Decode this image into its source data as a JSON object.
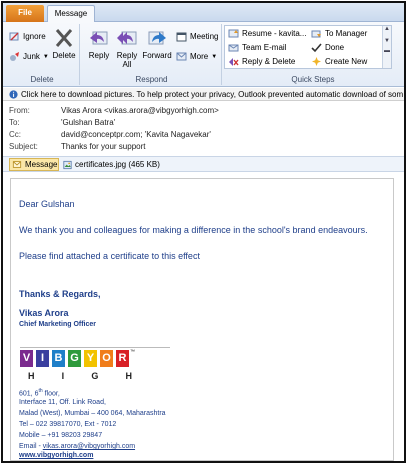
{
  "tabs": {
    "file": "File",
    "message": "Message"
  },
  "ribbon": {
    "delete_group": {
      "ignore": "Ignore",
      "junk": "Junk",
      "delete": "Delete",
      "label": "Delete"
    },
    "respond_group": {
      "reply": "Reply",
      "reply_all_line1": "Reply",
      "reply_all_line2": "All",
      "forward": "Forward",
      "meeting": "Meeting",
      "more": "More",
      "label": "Respond"
    },
    "quick_steps": {
      "items": [
        "Resume - kavita...",
        "Team E-mail",
        "Reply & Delete",
        "To Manager",
        "Done",
        "Create New"
      ],
      "label": "Quick Steps"
    }
  },
  "infobar": {
    "text": "Click here to download pictures. To help protect your privacy, Outlook prevented automatic download of som"
  },
  "header": {
    "from_label": "From:",
    "from": "Vikas Arora <vikas.arora@vibgyorhigh.com>",
    "to_label": "To:",
    "to": "'Gulshan Batra'",
    "cc_label": "Cc:",
    "cc": "david@conceptpr.com; 'Kavita Nagavekar'",
    "subject_label": "Subject:",
    "subject": "Thanks for your support"
  },
  "attachments": {
    "message_label": "Message",
    "file": "certificates.jpg (465 KB)"
  },
  "body": {
    "greeting": "Dear Gulshan",
    "para1": "We thank you and colleagues for making a difference in the school's brand endeavours.",
    "para2": "Please find attached a certificate to this effect",
    "closing": "Thanks & Regards,",
    "sig_name": "Vikas Arora",
    "sig_title": "Chief Marketing Officer",
    "logo_letters": [
      "V",
      "I",
      "B",
      "G",
      "Y",
      "O",
      "R"
    ],
    "logo_tm": "™",
    "logo_sub": [
      "H",
      "I",
      "G",
      "H"
    ],
    "address": {
      "line1_a": "601, 6",
      "line1_sup": "th",
      "line1_b": " floor,",
      "line2": "Interface 11, Off. Link Road,",
      "line3": "Malad  (West), Mumbai – 400 064, Maharashtra",
      "line4": "Tel – 022 39817070, Ext - 7012",
      "line5": "Mobile – +91 98203 29847",
      "email_label": "Email -  ",
      "email": "vikas.arora@vibgyorhigh.com",
      "website": "www.vibgyorhigh.com"
    }
  },
  "colors": {
    "logo": [
      "#7b2a8e",
      "#3a3f9f",
      "#1e7fc8",
      "#2e9a3c",
      "#f2c300",
      "#f07d1a",
      "#d81f26"
    ],
    "text_blue": "#1f3f8a",
    "file_tab": "#e8892a"
  },
  "icons": [
    "ignore-icon",
    "junk-icon",
    "delete-icon",
    "reply-icon",
    "reply-all-icon",
    "forward-icon",
    "meeting-icon",
    "more-icon",
    "quickstep-icon",
    "manager-icon",
    "done-icon",
    "create-new-icon",
    "info-icon",
    "message-icon",
    "attachment-icon"
  ]
}
